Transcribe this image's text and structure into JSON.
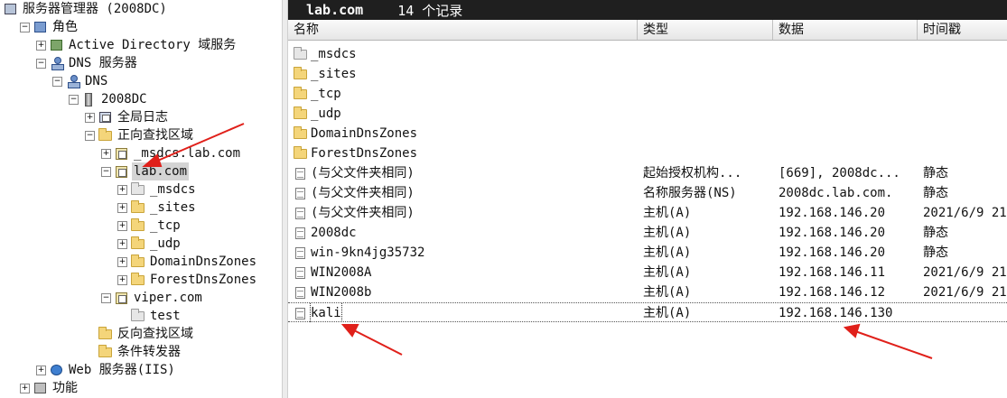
{
  "tree": [
    {
      "label": "服务器管理器 (2008DC)",
      "icon": "server-manager-icon",
      "exp": "",
      "sel": false,
      "indent": 0
    },
    {
      "label": "角色",
      "icon": "roles-icon",
      "exp": "−",
      "sel": false,
      "indent": 1
    },
    {
      "label": "Active Directory 域服务",
      "icon": "active-directory-icon",
      "exp": "+",
      "sel": false,
      "indent": 2
    },
    {
      "label": "DNS 服务器",
      "icon": "dns-server-icon",
      "exp": "−",
      "sel": false,
      "indent": 2
    },
    {
      "label": "DNS",
      "icon": "dns-icon",
      "exp": "−",
      "sel": false,
      "indent": 3
    },
    {
      "label": "2008DC",
      "icon": "server-icon",
      "exp": "−",
      "sel": false,
      "indent": 4
    },
    {
      "label": "全局日志",
      "icon": "global-log-icon",
      "exp": "+",
      "sel": false,
      "indent": 5
    },
    {
      "label": "正向查找区域",
      "icon": "folder-icon",
      "exp": "−",
      "sel": false,
      "indent": 5
    },
    {
      "label": "_msdcs.lab.com",
      "icon": "zone-icon",
      "exp": "+",
      "sel": false,
      "indent": 6
    },
    {
      "label": "lab.com",
      "icon": "zone-icon",
      "exp": "−",
      "sel": true,
      "indent": 6
    },
    {
      "label": "_msdcs",
      "icon": "zone-gray-icon",
      "exp": "+",
      "sel": false,
      "indent": 7
    },
    {
      "label": "_sites",
      "icon": "folder-icon",
      "exp": "+",
      "sel": false,
      "indent": 7
    },
    {
      "label": "_tcp",
      "icon": "folder-icon",
      "exp": "+",
      "sel": false,
      "indent": 7
    },
    {
      "label": "_udp",
      "icon": "folder-icon",
      "exp": "+",
      "sel": false,
      "indent": 7
    },
    {
      "label": "DomainDnsZones",
      "icon": "folder-icon",
      "exp": "+",
      "sel": false,
      "indent": 7
    },
    {
      "label": "ForestDnsZones",
      "icon": "folder-icon",
      "exp": "+",
      "sel": false,
      "indent": 7
    },
    {
      "label": "viper.com",
      "icon": "zone-icon",
      "exp": "−",
      "sel": false,
      "indent": 6
    },
    {
      "label": "test",
      "icon": "zone-gray-icon",
      "exp": "",
      "sel": false,
      "indent": 7
    },
    {
      "label": "反向查找区域",
      "icon": "folder-icon",
      "exp": "",
      "sel": false,
      "indent": 5
    },
    {
      "label": "条件转发器",
      "icon": "folder-icon",
      "exp": "",
      "sel": false,
      "indent": 5
    },
    {
      "label": "Web 服务器(IIS)",
      "icon": "web-server-icon",
      "exp": "+",
      "sel": false,
      "indent": 2
    },
    {
      "label": "功能",
      "icon": "features-icon",
      "exp": "+",
      "sel": false,
      "indent": 1
    }
  ],
  "panel": {
    "zone": "lab.com",
    "count": "14 个记录"
  },
  "columns": [
    "名称",
    "类型",
    "数据",
    "时间戳"
  ],
  "records": [
    {
      "name": "_msdcs",
      "icon": "folder-gray-icon",
      "type": "",
      "data": "",
      "ts": ""
    },
    {
      "name": "_sites",
      "icon": "folder-icon",
      "type": "",
      "data": "",
      "ts": ""
    },
    {
      "name": "_tcp",
      "icon": "folder-icon",
      "type": "",
      "data": "",
      "ts": ""
    },
    {
      "name": "_udp",
      "icon": "folder-icon",
      "type": "",
      "data": "",
      "ts": ""
    },
    {
      "name": "DomainDnsZones",
      "icon": "folder-icon",
      "type": "",
      "data": "",
      "ts": ""
    },
    {
      "name": "ForestDnsZones",
      "icon": "folder-icon",
      "type": "",
      "data": "",
      "ts": ""
    },
    {
      "name": "(与父文件夹相同)",
      "icon": "record-icon",
      "type": "起始授权机构...",
      "data": "[669], 2008dc...",
      "ts": "静态"
    },
    {
      "name": "(与父文件夹相同)",
      "icon": "record-icon",
      "type": "名称服务器(NS)",
      "data": "2008dc.lab.com.",
      "ts": "静态"
    },
    {
      "name": "(与父文件夹相同)",
      "icon": "record-icon",
      "type": "主机(A)",
      "data": "192.168.146.20",
      "ts": "2021/6/9 21"
    },
    {
      "name": "2008dc",
      "icon": "record-icon",
      "type": "主机(A)",
      "data": "192.168.146.20",
      "ts": "静态"
    },
    {
      "name": "win-9kn4jg35732",
      "icon": "record-icon",
      "type": "主机(A)",
      "data": "192.168.146.20",
      "ts": "静态"
    },
    {
      "name": "WIN2008A",
      "icon": "record-icon",
      "type": "主机(A)",
      "data": "192.168.146.11",
      "ts": "2021/6/9 21"
    },
    {
      "name": "WIN2008b",
      "icon": "record-icon",
      "type": "主机(A)",
      "data": "192.168.146.12",
      "ts": "2021/6/9 21"
    },
    {
      "name": "kali",
      "icon": "record-icon",
      "type": "主机(A)",
      "data": "192.168.146.130",
      "ts": ""
    }
  ],
  "colors": {
    "header_bg": "#1f1f1f",
    "arrow": "#e0201a",
    "selection": "#d4d4d4"
  }
}
